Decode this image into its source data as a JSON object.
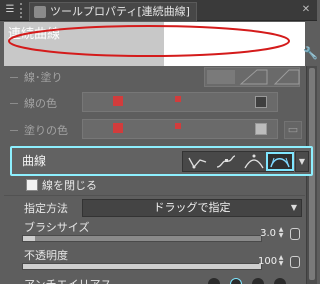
{
  "panel": {
    "title": "ツールプロパティ[連続曲線]",
    "preview_label": "連続曲線"
  },
  "props": {
    "line_fill": "線･塗り",
    "line_color": "線の色",
    "fill_color": "塗りの色",
    "curve": "曲線",
    "close_line": "線を閉じる",
    "spec_method": "指定方法",
    "spec_method_value": "ドラッグで指定",
    "brush_size": "ブラシサイズ",
    "brush_size_value": "3.0",
    "opacity": "不透明度",
    "opacity_value": "100",
    "antialias": "アンチエイリアス"
  },
  "levels": {
    "brush_size": 0.05,
    "opacity": 1.0
  },
  "curve_options": [
    "polyline-icon",
    "spline-icon",
    "quadratic-bezier-icon",
    "cubic-bezier-icon"
  ],
  "curve_selected": 3,
  "colors": {
    "highlight": "#8ef0ff",
    "stroke_preview": "#d41b1b",
    "swatch_red": "#d23c3c"
  }
}
